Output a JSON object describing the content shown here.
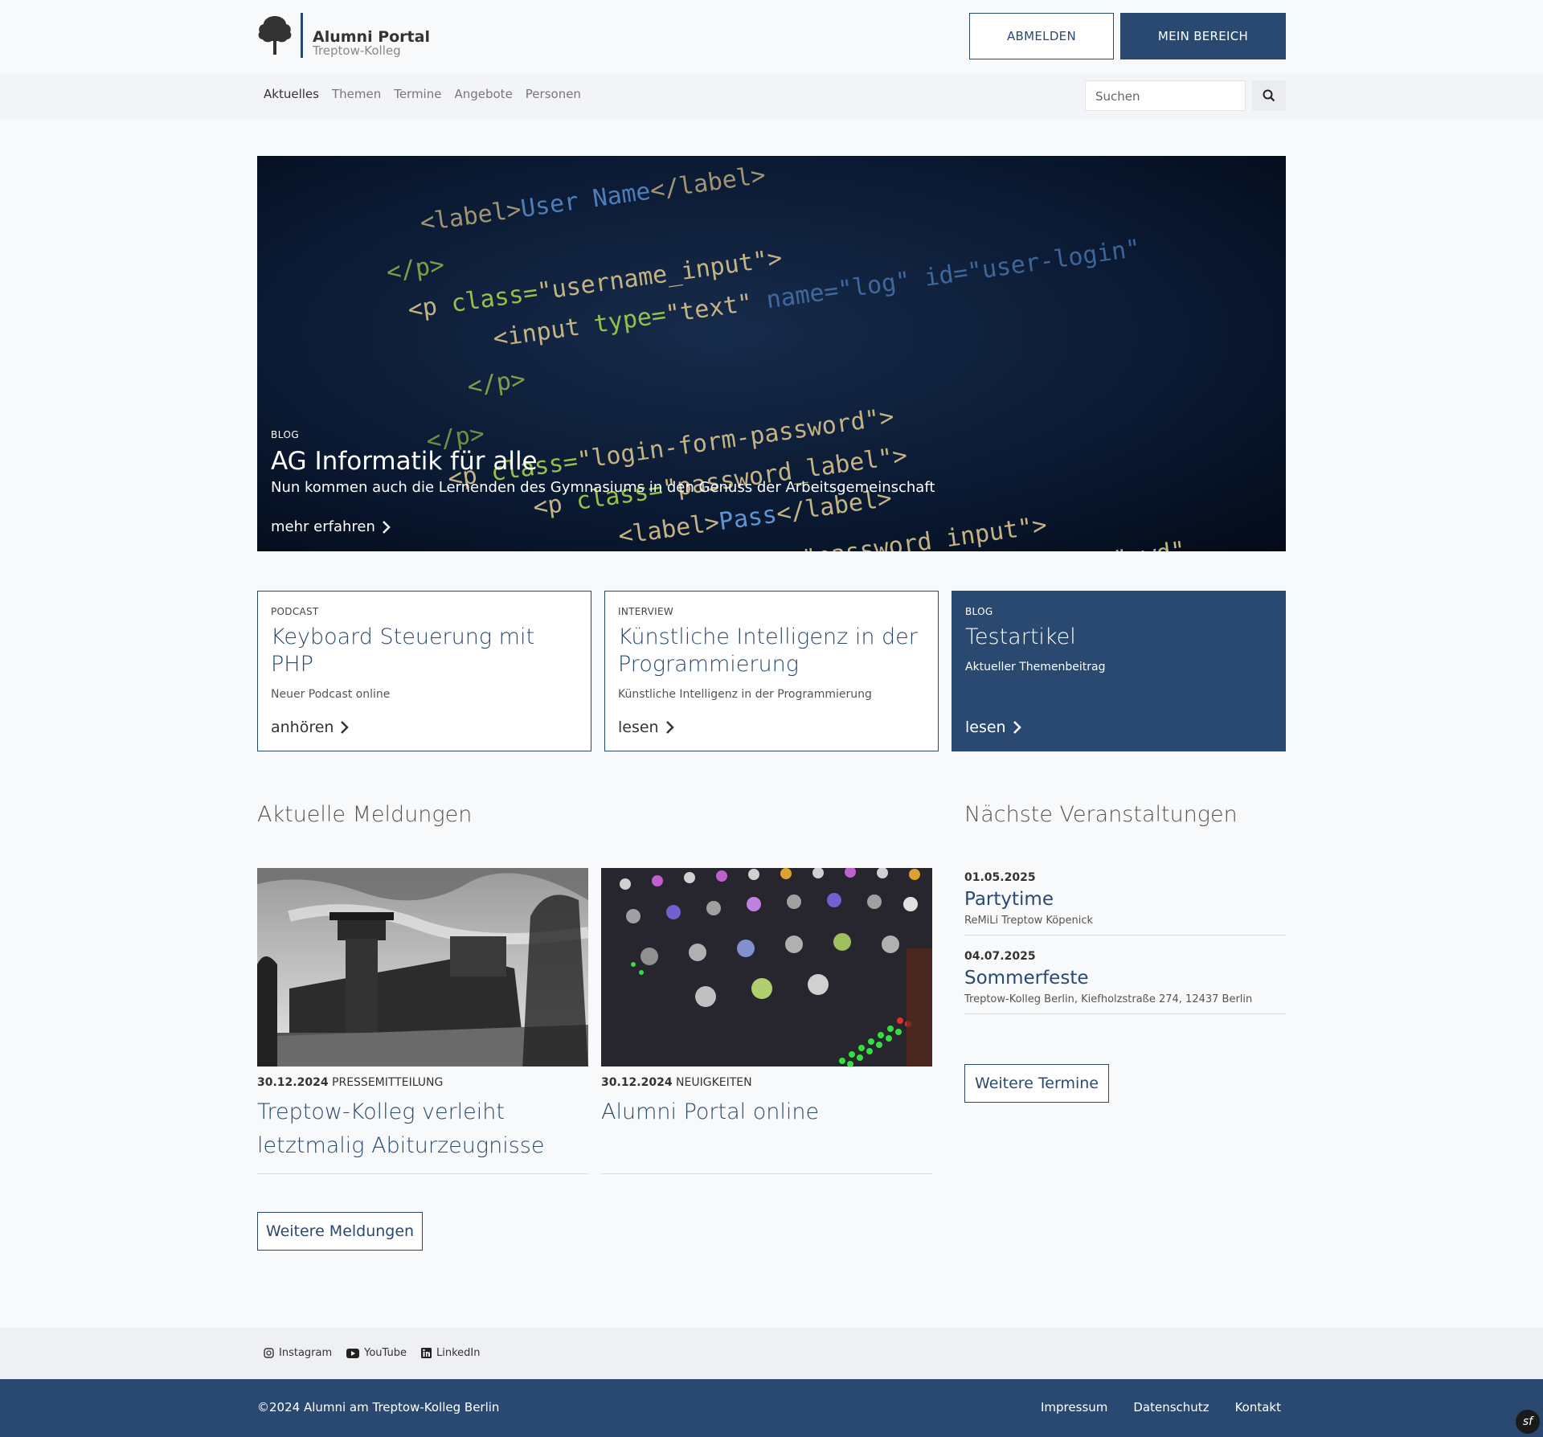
{
  "header": {
    "logo_title": "Alumni Portal",
    "logo_subtitle": "Treptow-Kolleg",
    "logout_label": "ABMELDEN",
    "my_area_label": "MEIN BEREICH"
  },
  "nav": {
    "items": [
      "Aktuelles",
      "Themen",
      "Termine",
      "Angebote",
      "Personen"
    ],
    "active": "Aktuelles",
    "search_placeholder": "Suchen"
  },
  "hero": {
    "category": "BLOG",
    "title": "AG Informatik für alle",
    "subtitle": "Nun kommen auch die Lernenden des Gymnasiums in den Genuss der Arbeitsgemeinschaft",
    "link": "mehr erfahren"
  },
  "cards": [
    {
      "category": "PODCAST",
      "title": "Keyboard Steuerung mit PHP",
      "subtitle": "Neuer Podcast online",
      "link": "anhören"
    },
    {
      "category": "INTERVIEW",
      "title": "Künstliche Intelligenz in der Programmierung",
      "subtitle": "Künstliche Intelligenz in der Programmierung",
      "link": "lesen"
    },
    {
      "category": "BLOG",
      "title": "Testartikel",
      "subtitle": "Aktueller Themenbeitrag",
      "link": "lesen"
    }
  ],
  "news": {
    "heading": "Aktuelle Meldungen",
    "items": [
      {
        "date": "30.12.2024",
        "category": "PRESSEMITTEILUNG",
        "title": "Treptow-Kolleg verleiht letztmalig Abiturzeugnisse"
      },
      {
        "date": "30.12.2024",
        "category": "NEUIGKEITEN",
        "title": "Alumni Portal online"
      }
    ],
    "more_label": "Weitere Meldungen"
  },
  "events": {
    "heading": "Nächste Veranstaltungen",
    "items": [
      {
        "date": "01.05.2025",
        "title": "Partytime",
        "location": "ReMiLi Treptow Köpenick"
      },
      {
        "date": "04.07.2025",
        "title": "Sommerfeste",
        "location": "Treptow-Kolleg Berlin, Kiefholzstraße 274, 12437 Berlin"
      }
    ],
    "more_label": "Weitere Termine"
  },
  "social": [
    "Instagram",
    "YouTube",
    "LinkedIn"
  ],
  "footer": {
    "copyright": "©2024 Alumni am Treptow-Kolleg Berlin",
    "links": [
      "Impressum",
      "Datenschutz",
      "Kontakt"
    ]
  },
  "colors": {
    "primary": "#2a4970",
    "background": "#f8f9fb"
  }
}
